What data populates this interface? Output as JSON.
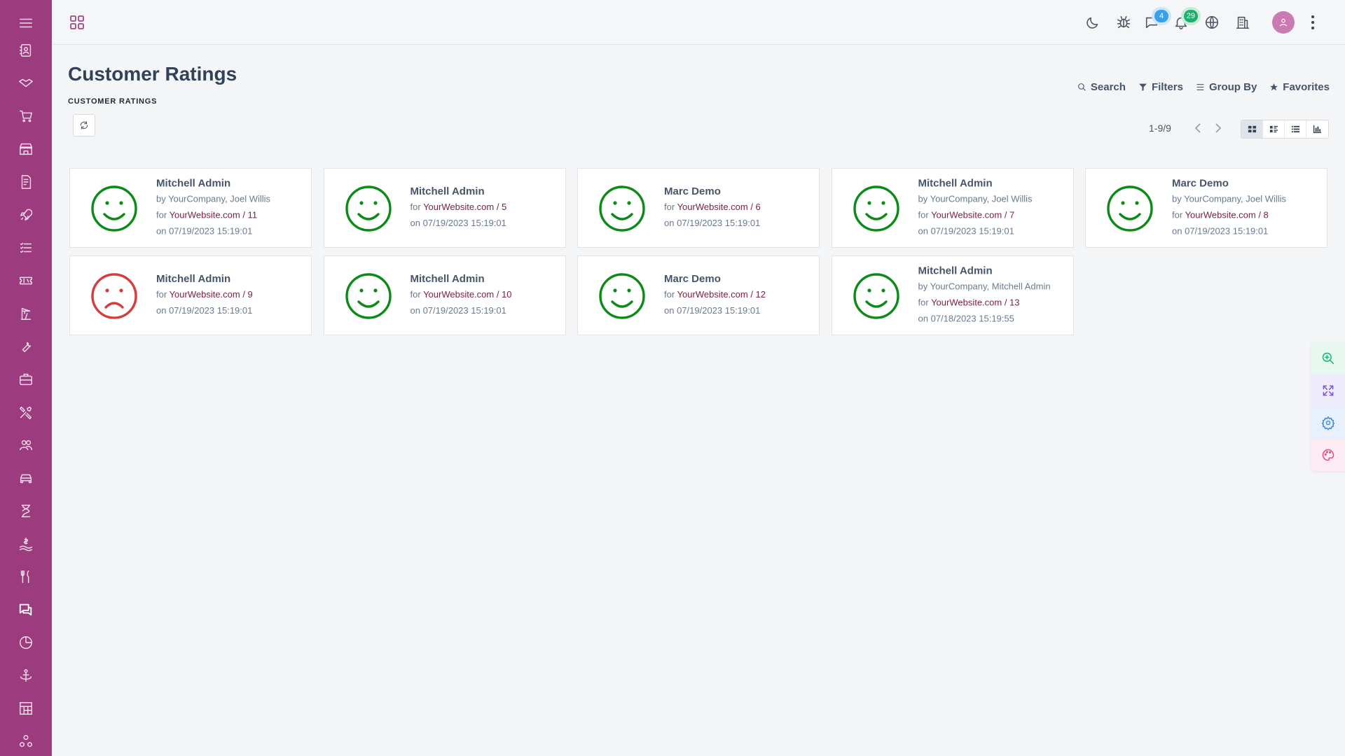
{
  "colors": {
    "sidebar": "#9c3b7e",
    "happy": "#0b8a17",
    "sad": "#d63c3c",
    "link": "#7a1f3f"
  },
  "sidebar": {
    "items": [
      {
        "icon": "contacts-icon"
      },
      {
        "icon": "handshake-icon"
      },
      {
        "icon": "cart-icon"
      },
      {
        "icon": "store-icon"
      },
      {
        "icon": "invoice-icon"
      },
      {
        "icon": "rocket-icon"
      },
      {
        "icon": "list-icon"
      },
      {
        "icon": "ticket-icon"
      },
      {
        "icon": "crane-icon"
      },
      {
        "icon": "wrench-icon"
      },
      {
        "icon": "briefcase-icon"
      },
      {
        "icon": "tools-icon"
      },
      {
        "icon": "users-icon"
      },
      {
        "icon": "car-icon"
      },
      {
        "icon": "hourglass-icon"
      },
      {
        "icon": "payroll-icon"
      },
      {
        "icon": "utensils-icon"
      },
      {
        "icon": "chat-icon",
        "active": true
      },
      {
        "icon": "pie-chart-icon"
      },
      {
        "icon": "anchor-icon"
      },
      {
        "icon": "dashboard-icon"
      },
      {
        "icon": "modules-icon"
      }
    ]
  },
  "topbar": {
    "messages_count": "4",
    "notifications_count": "29"
  },
  "page": {
    "title": "Customer Ratings",
    "breadcrumb": "CUSTOMER RATINGS"
  },
  "search_panel": {
    "search": "Search",
    "filters": "Filters",
    "group_by": "Group By",
    "favorites": "Favorites"
  },
  "pager": {
    "value": "1-9/9"
  },
  "ratings": [
    {
      "name": "Mitchell Admin",
      "by": "by YourCompany, Joel Willis",
      "for_prefix": "for ",
      "site": "YourWebsite.com / 11",
      "on": "on 07/19/2023 15:19:01",
      "mood": "happy"
    },
    {
      "name": "Mitchell Admin",
      "by": "",
      "for_prefix": "for ",
      "site": "YourWebsite.com / 5",
      "on": "on 07/19/2023 15:19:01",
      "mood": "happy"
    },
    {
      "name": "Marc Demo",
      "by": "",
      "for_prefix": "for ",
      "site": "YourWebsite.com / 6",
      "on": "on 07/19/2023 15:19:01",
      "mood": "happy"
    },
    {
      "name": "Mitchell Admin",
      "by": "by YourCompany, Joel Willis",
      "for_prefix": "for ",
      "site": "YourWebsite.com / 7",
      "on": "on 07/19/2023 15:19:01",
      "mood": "happy"
    },
    {
      "name": "Marc Demo",
      "by": "by YourCompany, Joel Willis",
      "for_prefix": "for ",
      "site": "YourWebsite.com / 8",
      "on": "on 07/19/2023 15:19:01",
      "mood": "happy"
    },
    {
      "name": "Mitchell Admin",
      "by": "",
      "for_prefix": "for ",
      "site": "YourWebsite.com / 9",
      "on": "on 07/19/2023 15:19:01",
      "mood": "sad"
    },
    {
      "name": "Mitchell Admin",
      "by": "",
      "for_prefix": "for ",
      "site": "YourWebsite.com / 10",
      "on": "on 07/19/2023 15:19:01",
      "mood": "happy"
    },
    {
      "name": "Marc Demo",
      "by": "",
      "for_prefix": "for ",
      "site": "YourWebsite.com / 12",
      "on": "on 07/19/2023 15:19:01",
      "mood": "happy"
    },
    {
      "name": "Mitchell Admin",
      "by": "by YourCompany, Mitchell Admin",
      "for_prefix": "for ",
      "site": "YourWebsite.com / 13",
      "on": "on 07/18/2023 15:19:55",
      "mood": "happy"
    }
  ],
  "float_tools": [
    {
      "icon": "zoom-in-icon",
      "color": "#16b47c",
      "bg": "#e8f8f1"
    },
    {
      "icon": "expand-icon",
      "color": "#7b5cd6",
      "bg": "#eeebfb"
    },
    {
      "icon": "settings-icon",
      "color": "#3a8bd6",
      "bg": "#e8f1fb"
    },
    {
      "icon": "palette-icon",
      "color": "#e04e86",
      "bg": "#fcebf2"
    }
  ]
}
